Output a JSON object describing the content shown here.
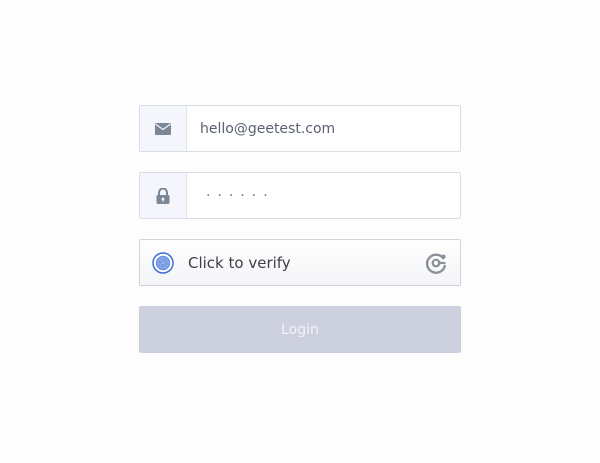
{
  "form": {
    "email": {
      "icon": "envelope-icon",
      "value": "hello@geetest.com",
      "placeholder": ""
    },
    "password": {
      "icon": "lock-icon",
      "masked_value": "······"
    },
    "captcha": {
      "icon": "fingerprint-icon",
      "label": "Click to verify",
      "logo": "geetest-logo-icon"
    },
    "login_button": {
      "label": "Login"
    }
  },
  "colors": {
    "accent": "#3e6fd8",
    "icon_gray": "#7c8798",
    "button_disabled": "#cbcfde",
    "border": "#d8dee6"
  }
}
